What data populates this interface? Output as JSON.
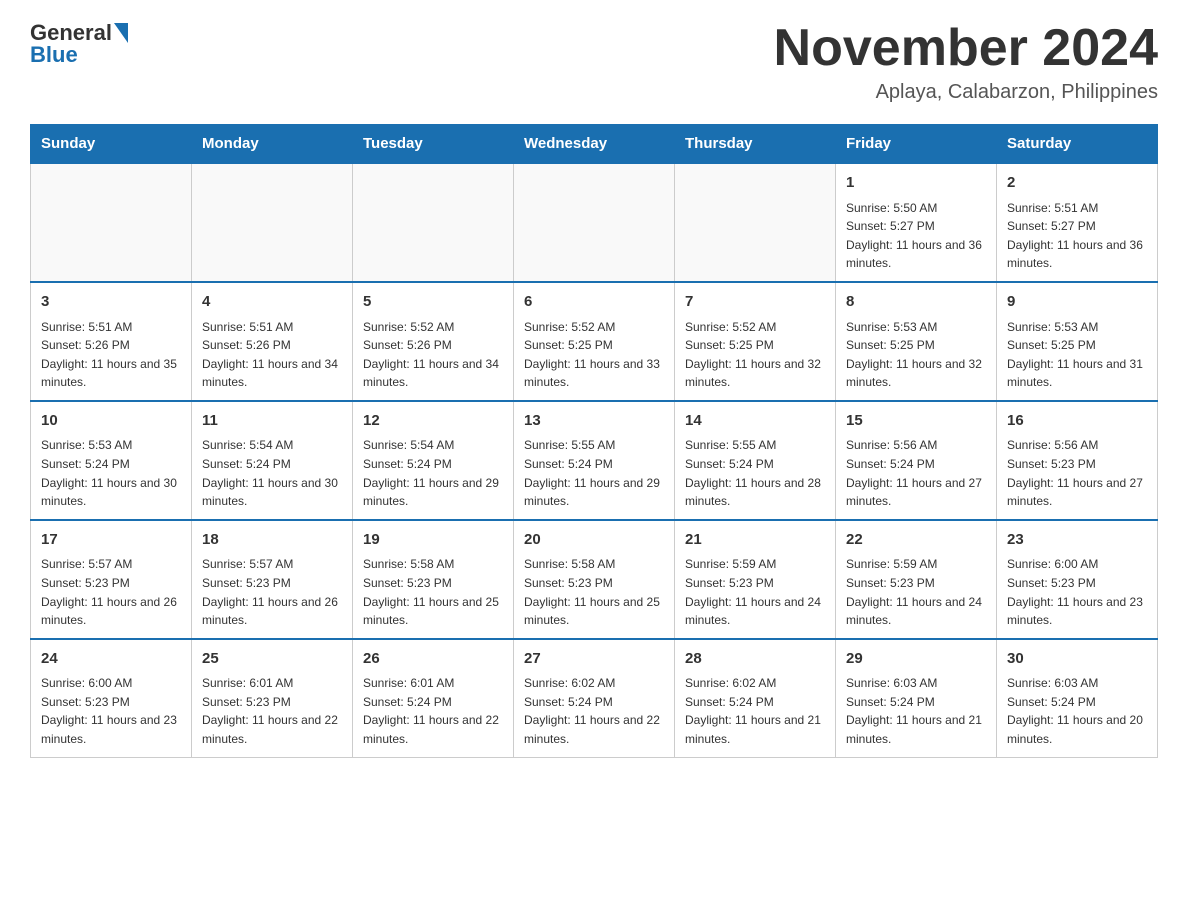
{
  "header": {
    "logo": {
      "text_general": "General",
      "text_blue": "Blue"
    },
    "month_title": "November 2024",
    "location": "Aplaya, Calabarzon, Philippines"
  },
  "weekdays": [
    "Sunday",
    "Monday",
    "Tuesday",
    "Wednesday",
    "Thursday",
    "Friday",
    "Saturday"
  ],
  "weeks": [
    [
      {
        "day": "",
        "sunrise": "",
        "sunset": "",
        "daylight": ""
      },
      {
        "day": "",
        "sunrise": "",
        "sunset": "",
        "daylight": ""
      },
      {
        "day": "",
        "sunrise": "",
        "sunset": "",
        "daylight": ""
      },
      {
        "day": "",
        "sunrise": "",
        "sunset": "",
        "daylight": ""
      },
      {
        "day": "",
        "sunrise": "",
        "sunset": "",
        "daylight": ""
      },
      {
        "day": "1",
        "sunrise": "Sunrise: 5:50 AM",
        "sunset": "Sunset: 5:27 PM",
        "daylight": "Daylight: 11 hours and 36 minutes."
      },
      {
        "day": "2",
        "sunrise": "Sunrise: 5:51 AM",
        "sunset": "Sunset: 5:27 PM",
        "daylight": "Daylight: 11 hours and 36 minutes."
      }
    ],
    [
      {
        "day": "3",
        "sunrise": "Sunrise: 5:51 AM",
        "sunset": "Sunset: 5:26 PM",
        "daylight": "Daylight: 11 hours and 35 minutes."
      },
      {
        "day": "4",
        "sunrise": "Sunrise: 5:51 AM",
        "sunset": "Sunset: 5:26 PM",
        "daylight": "Daylight: 11 hours and 34 minutes."
      },
      {
        "day": "5",
        "sunrise": "Sunrise: 5:52 AM",
        "sunset": "Sunset: 5:26 PM",
        "daylight": "Daylight: 11 hours and 34 minutes."
      },
      {
        "day": "6",
        "sunrise": "Sunrise: 5:52 AM",
        "sunset": "Sunset: 5:25 PM",
        "daylight": "Daylight: 11 hours and 33 minutes."
      },
      {
        "day": "7",
        "sunrise": "Sunrise: 5:52 AM",
        "sunset": "Sunset: 5:25 PM",
        "daylight": "Daylight: 11 hours and 32 minutes."
      },
      {
        "day": "8",
        "sunrise": "Sunrise: 5:53 AM",
        "sunset": "Sunset: 5:25 PM",
        "daylight": "Daylight: 11 hours and 32 minutes."
      },
      {
        "day": "9",
        "sunrise": "Sunrise: 5:53 AM",
        "sunset": "Sunset: 5:25 PM",
        "daylight": "Daylight: 11 hours and 31 minutes."
      }
    ],
    [
      {
        "day": "10",
        "sunrise": "Sunrise: 5:53 AM",
        "sunset": "Sunset: 5:24 PM",
        "daylight": "Daylight: 11 hours and 30 minutes."
      },
      {
        "day": "11",
        "sunrise": "Sunrise: 5:54 AM",
        "sunset": "Sunset: 5:24 PM",
        "daylight": "Daylight: 11 hours and 30 minutes."
      },
      {
        "day": "12",
        "sunrise": "Sunrise: 5:54 AM",
        "sunset": "Sunset: 5:24 PM",
        "daylight": "Daylight: 11 hours and 29 minutes."
      },
      {
        "day": "13",
        "sunrise": "Sunrise: 5:55 AM",
        "sunset": "Sunset: 5:24 PM",
        "daylight": "Daylight: 11 hours and 29 minutes."
      },
      {
        "day": "14",
        "sunrise": "Sunrise: 5:55 AM",
        "sunset": "Sunset: 5:24 PM",
        "daylight": "Daylight: 11 hours and 28 minutes."
      },
      {
        "day": "15",
        "sunrise": "Sunrise: 5:56 AM",
        "sunset": "Sunset: 5:24 PM",
        "daylight": "Daylight: 11 hours and 27 minutes."
      },
      {
        "day": "16",
        "sunrise": "Sunrise: 5:56 AM",
        "sunset": "Sunset: 5:23 PM",
        "daylight": "Daylight: 11 hours and 27 minutes."
      }
    ],
    [
      {
        "day": "17",
        "sunrise": "Sunrise: 5:57 AM",
        "sunset": "Sunset: 5:23 PM",
        "daylight": "Daylight: 11 hours and 26 minutes."
      },
      {
        "day": "18",
        "sunrise": "Sunrise: 5:57 AM",
        "sunset": "Sunset: 5:23 PM",
        "daylight": "Daylight: 11 hours and 26 minutes."
      },
      {
        "day": "19",
        "sunrise": "Sunrise: 5:58 AM",
        "sunset": "Sunset: 5:23 PM",
        "daylight": "Daylight: 11 hours and 25 minutes."
      },
      {
        "day": "20",
        "sunrise": "Sunrise: 5:58 AM",
        "sunset": "Sunset: 5:23 PM",
        "daylight": "Daylight: 11 hours and 25 minutes."
      },
      {
        "day": "21",
        "sunrise": "Sunrise: 5:59 AM",
        "sunset": "Sunset: 5:23 PM",
        "daylight": "Daylight: 11 hours and 24 minutes."
      },
      {
        "day": "22",
        "sunrise": "Sunrise: 5:59 AM",
        "sunset": "Sunset: 5:23 PM",
        "daylight": "Daylight: 11 hours and 24 minutes."
      },
      {
        "day": "23",
        "sunrise": "Sunrise: 6:00 AM",
        "sunset": "Sunset: 5:23 PM",
        "daylight": "Daylight: 11 hours and 23 minutes."
      }
    ],
    [
      {
        "day": "24",
        "sunrise": "Sunrise: 6:00 AM",
        "sunset": "Sunset: 5:23 PM",
        "daylight": "Daylight: 11 hours and 23 minutes."
      },
      {
        "day": "25",
        "sunrise": "Sunrise: 6:01 AM",
        "sunset": "Sunset: 5:23 PM",
        "daylight": "Daylight: 11 hours and 22 minutes."
      },
      {
        "day": "26",
        "sunrise": "Sunrise: 6:01 AM",
        "sunset": "Sunset: 5:24 PM",
        "daylight": "Daylight: 11 hours and 22 minutes."
      },
      {
        "day": "27",
        "sunrise": "Sunrise: 6:02 AM",
        "sunset": "Sunset: 5:24 PM",
        "daylight": "Daylight: 11 hours and 22 minutes."
      },
      {
        "day": "28",
        "sunrise": "Sunrise: 6:02 AM",
        "sunset": "Sunset: 5:24 PM",
        "daylight": "Daylight: 11 hours and 21 minutes."
      },
      {
        "day": "29",
        "sunrise": "Sunrise: 6:03 AM",
        "sunset": "Sunset: 5:24 PM",
        "daylight": "Daylight: 11 hours and 21 minutes."
      },
      {
        "day": "30",
        "sunrise": "Sunrise: 6:03 AM",
        "sunset": "Sunset: 5:24 PM",
        "daylight": "Daylight: 11 hours and 20 minutes."
      }
    ]
  ]
}
